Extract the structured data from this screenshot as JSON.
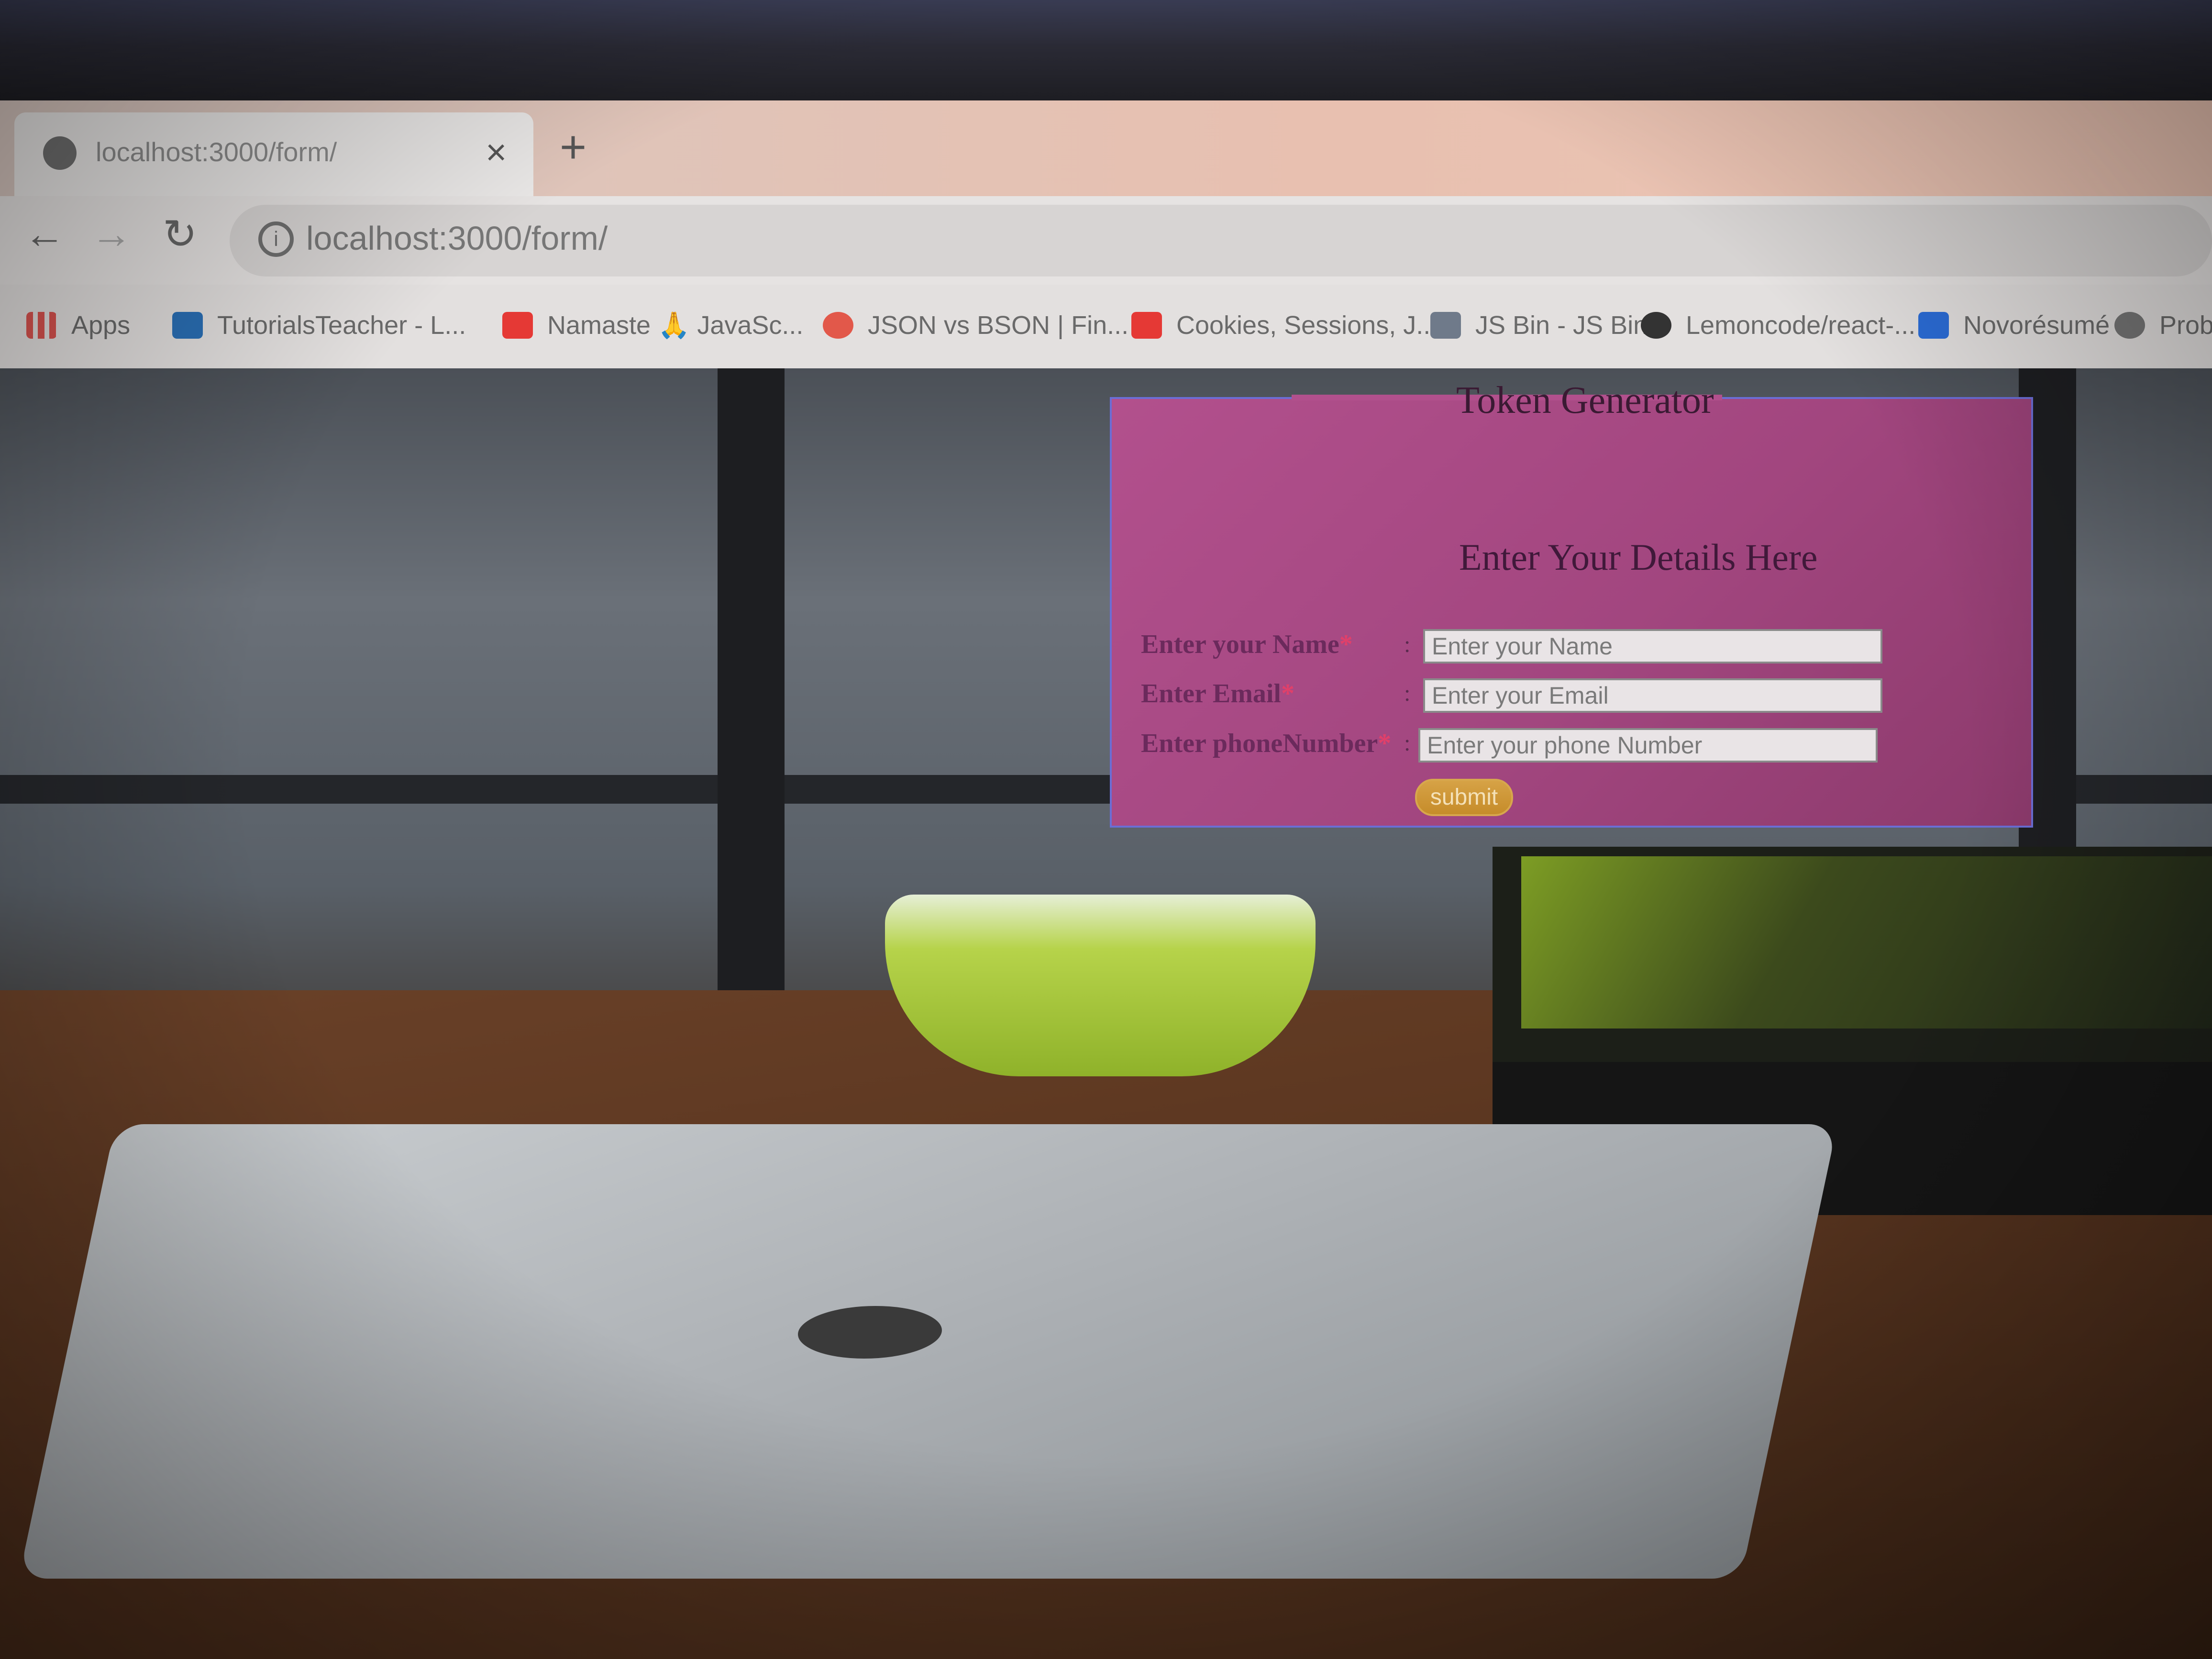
{
  "browser": {
    "tab": {
      "title": "localhost:3000/form/",
      "close_icon": "×"
    },
    "new_tab_icon": "+",
    "nav": {
      "back_icon": "←",
      "forward_icon": "→",
      "reload_icon": "↻"
    },
    "address_bar": {
      "url": "localhost:3000/form/",
      "info_icon": "i"
    },
    "bookmarks": [
      {
        "label": "Apps",
        "icon": "apps-grid-icon",
        "color": "#d9534f"
      },
      {
        "label": "TutorialsTeacher - L...",
        "icon": "tutorialsteacher-icon",
        "color": "#2a6fb5"
      },
      {
        "label": "Namaste 🙏 JavaSc...",
        "icon": "youtube-icon",
        "color": "#e53935"
      },
      {
        "label": "JSON vs BSON | Fin...",
        "icon": "site-icon",
        "color": "#e2584a"
      },
      {
        "label": "Cookies, Sessions, J...",
        "icon": "youtube-icon",
        "color": "#e53935"
      },
      {
        "label": "JS Bin - JS Bin",
        "icon": "jsbin-icon",
        "color": "#6f7a8a"
      },
      {
        "label": "Lemoncode/react-...",
        "icon": "github-icon",
        "color": "#333333"
      },
      {
        "label": "Novorésumé",
        "icon": "novoresume-icon",
        "color": "#2b6cd6"
      },
      {
        "label": "Proble",
        "icon": "site-icon",
        "color": "#777777"
      }
    ]
  },
  "form": {
    "legend": "Token Generator",
    "heading": "Enter Your Details Here",
    "fields": [
      {
        "label": "Enter your Name",
        "required_mark": "*",
        "colon": ":",
        "placeholder": "Enter your Name"
      },
      {
        "label": "Enter Email",
        "required_mark": "*",
        "colon": ":",
        "placeholder": "Enter your Email"
      },
      {
        "label": "Enter phoneNumber",
        "required_mark": "*",
        "colon": ":",
        "placeholder": "Enter your phone Number"
      }
    ],
    "submit_label": "submit",
    "colors": {
      "panel": "#b2508d",
      "border": "#6b6ed6",
      "button": "#c68c2a",
      "required": "#e0406a"
    }
  }
}
